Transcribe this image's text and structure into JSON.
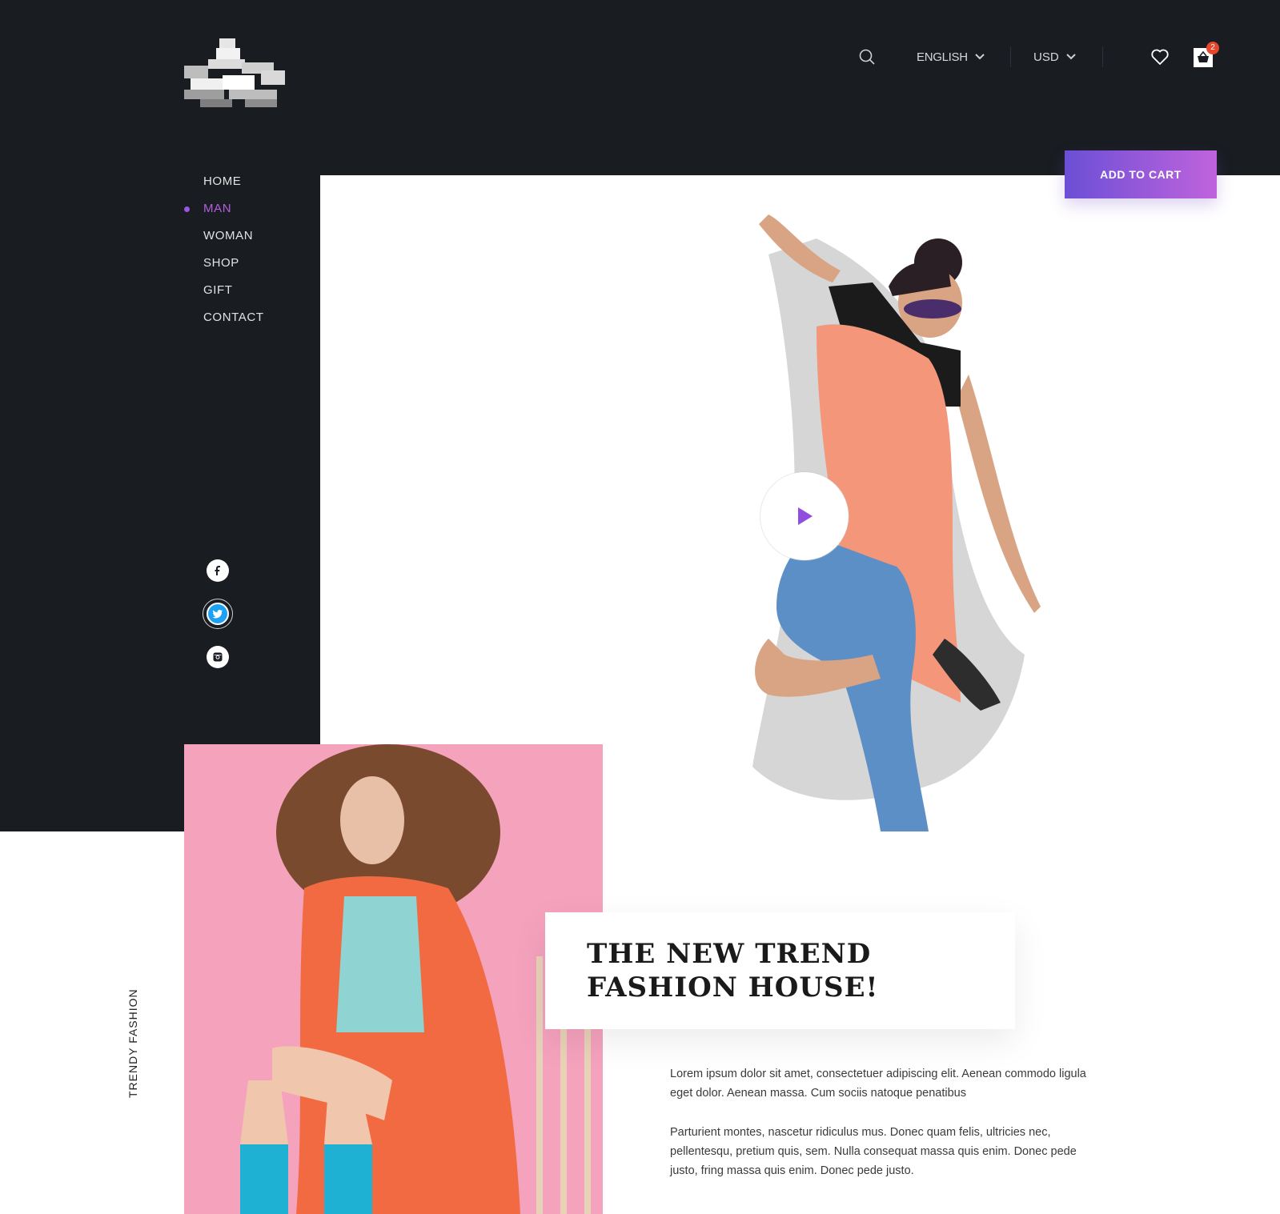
{
  "header": {
    "language": "ENGLISH",
    "currency": "USD",
    "cart_count": "2",
    "cta_label": "ADD TO CART"
  },
  "nav": {
    "items": [
      {
        "label": "HOME",
        "active": false
      },
      {
        "label": "MAN",
        "active": true
      },
      {
        "label": "WOMAN",
        "active": false
      },
      {
        "label": "SHOP",
        "active": false
      },
      {
        "label": "GIFT",
        "active": false
      },
      {
        "label": "CONTACT",
        "active": false
      }
    ]
  },
  "social": {
    "icons": [
      "facebook-icon",
      "twitter-icon",
      "instagram-icon"
    ]
  },
  "hero": {
    "play_icon": "play-icon"
  },
  "feature": {
    "side_label": "TRENDY FASHION",
    "headline": "THE NEW TREND FASHION HOUSE!",
    "paragraph_1": "Lorem ipsum dolor sit amet, consectetuer adipiscing elit. Aenean commodo ligula eget dolor. Aenean massa. Cum sociis natoque penatibus",
    "paragraph_2": "Parturient montes, nascetur ridiculus mus. Donec quam felis, ultricies nec, pellentesqu, pretium quis, sem. Nulla consequat massa quis enim. Donec pede justo, fring massa quis enim. Donec pede justo."
  },
  "colors": {
    "dark_bg": "#191c21",
    "accent_purple": "#9a55e6",
    "cta_gradient_start": "#6b4fd6",
    "cta_gradient_end": "#c063dc",
    "badge_red": "#e8462b",
    "pink_bg": "#f5a2bd"
  }
}
